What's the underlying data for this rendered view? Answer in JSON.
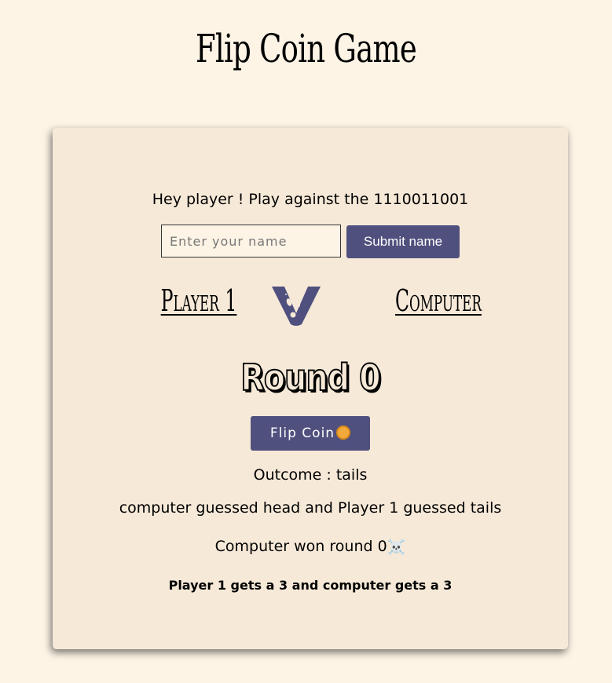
{
  "header": {
    "title": "Flip Coin Game"
  },
  "card": {
    "intro": "Hey player ! Play against the 1110011001",
    "name_input": {
      "value": "",
      "placeholder": "Enter your name"
    },
    "submit_label": "Submit name",
    "player_label": "Player 1",
    "computer_label": "Computer",
    "vs_icon": "vs-logo-icon",
    "round_title": "Round 0",
    "flip_label": "Flip Coin",
    "coin_icon": "coin-icon",
    "outcome": "Outcome : tails",
    "guesses": "computer guessed head and Player 1 guessed tails",
    "round_result": "Computer won round 0",
    "skull_icon": "☠️",
    "score": "Player 1 gets a 3 and computer gets a 3"
  },
  "colors": {
    "page_bg": "#fdf4e6",
    "card_bg": "#f6e9d8",
    "accent": "#50507e",
    "coin": "#f0a93a"
  }
}
